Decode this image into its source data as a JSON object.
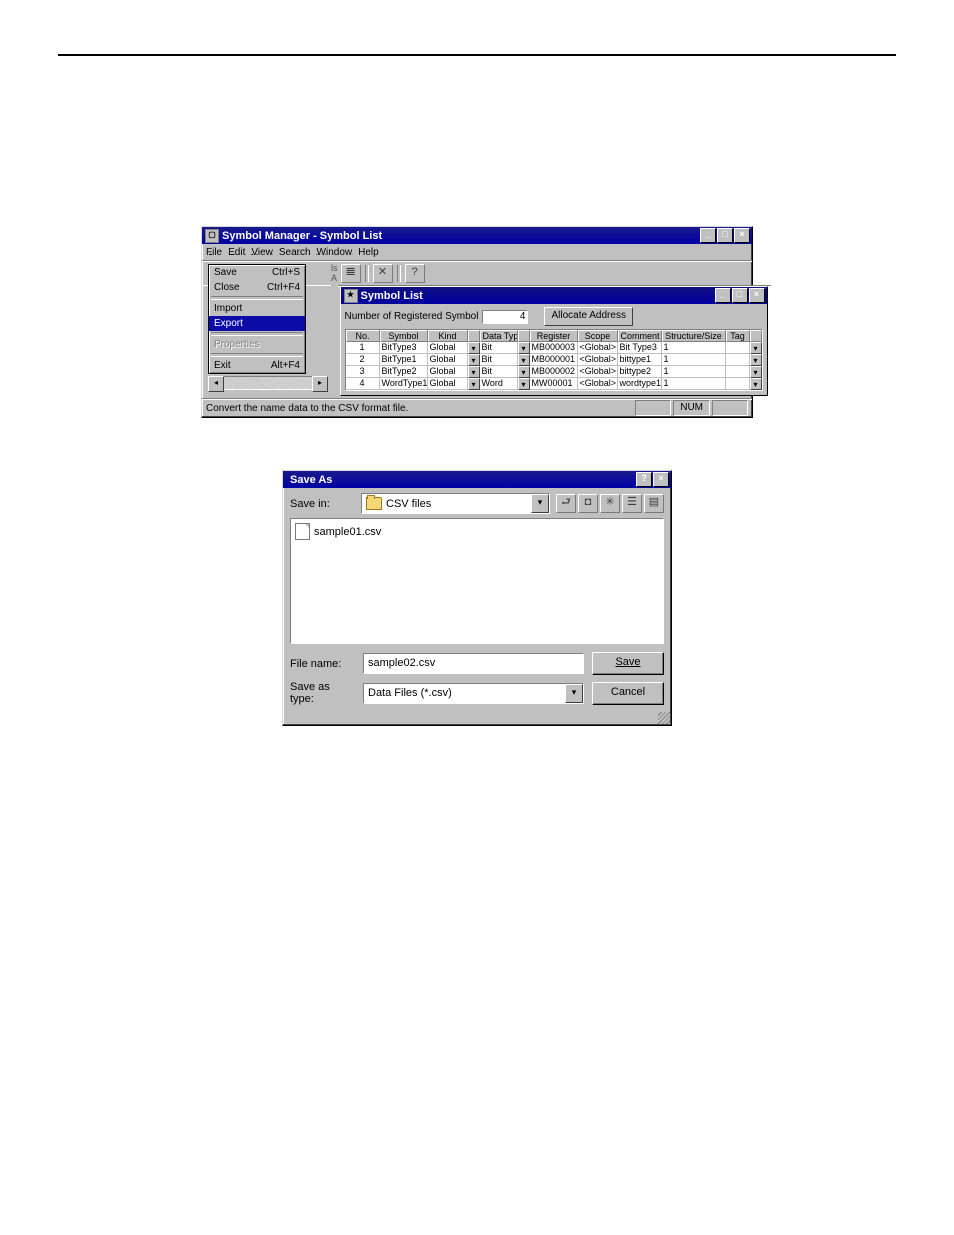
{
  "symbol_manager": {
    "title": "Symbol Manager - Symbol List",
    "menubar": [
      "File",
      "Edit",
      "View",
      "Search",
      "Window",
      "Help"
    ],
    "file_menu": {
      "save": {
        "label": "Save",
        "accel": "Ctrl+S"
      },
      "close": {
        "label": "Close",
        "accel": "Ctrl+F4"
      },
      "import": {
        "label": "Import"
      },
      "export": {
        "label": "Export"
      },
      "properties": {
        "label": "Properties"
      },
      "exit": {
        "label": "Exit",
        "accel": "Alt+F4"
      }
    },
    "mdi_crumb": "ls A",
    "status_text": "Convert the name data to the CSV format file.",
    "status_num": "NUM",
    "symbol_list": {
      "title": "Symbol List",
      "nregistered_label": "Number of  Registered Symbol",
      "nregistered_value": "4",
      "allocate_btn": "Allocate Address",
      "headers": [
        "No.",
        "Symbol",
        "Kind",
        "Data Type",
        "Register",
        "Scope",
        "Comment",
        "Structure/Size",
        "Tag"
      ],
      "rows": [
        {
          "no": "1",
          "symbol": "BitType3",
          "kind": "Global",
          "dt": "Bit",
          "reg": "MB000003",
          "scope": "<Global>",
          "comment": "Bit Type3",
          "ss": "1"
        },
        {
          "no": "2",
          "symbol": "BitType1",
          "kind": "Global",
          "dt": "Bit",
          "reg": "MB000001",
          "scope": "<Global>",
          "comment": "bittype1",
          "ss": "1"
        },
        {
          "no": "3",
          "symbol": "BitType2",
          "kind": "Global",
          "dt": "Bit",
          "reg": "MB000002",
          "scope": "<Global>",
          "comment": "bittype2",
          "ss": "1"
        },
        {
          "no": "4",
          "symbol": "WordType1",
          "kind": "Global",
          "dt": "Word",
          "reg": "MW00001",
          "scope": "<Global>",
          "comment": "wordtype1",
          "ss": "1"
        }
      ]
    }
  },
  "save_as": {
    "title": "Save As",
    "save_in_label": "Save in:",
    "save_in_value": "CSV files",
    "file_list": [
      "sample01.csv"
    ],
    "file_name_label": "File name:",
    "file_name_value": "sample02.csv",
    "save_as_type_label": "Save as type:",
    "save_as_type_value": "Data Files (*.csv)",
    "save_btn": "Save",
    "cancel_btn": "Cancel"
  }
}
